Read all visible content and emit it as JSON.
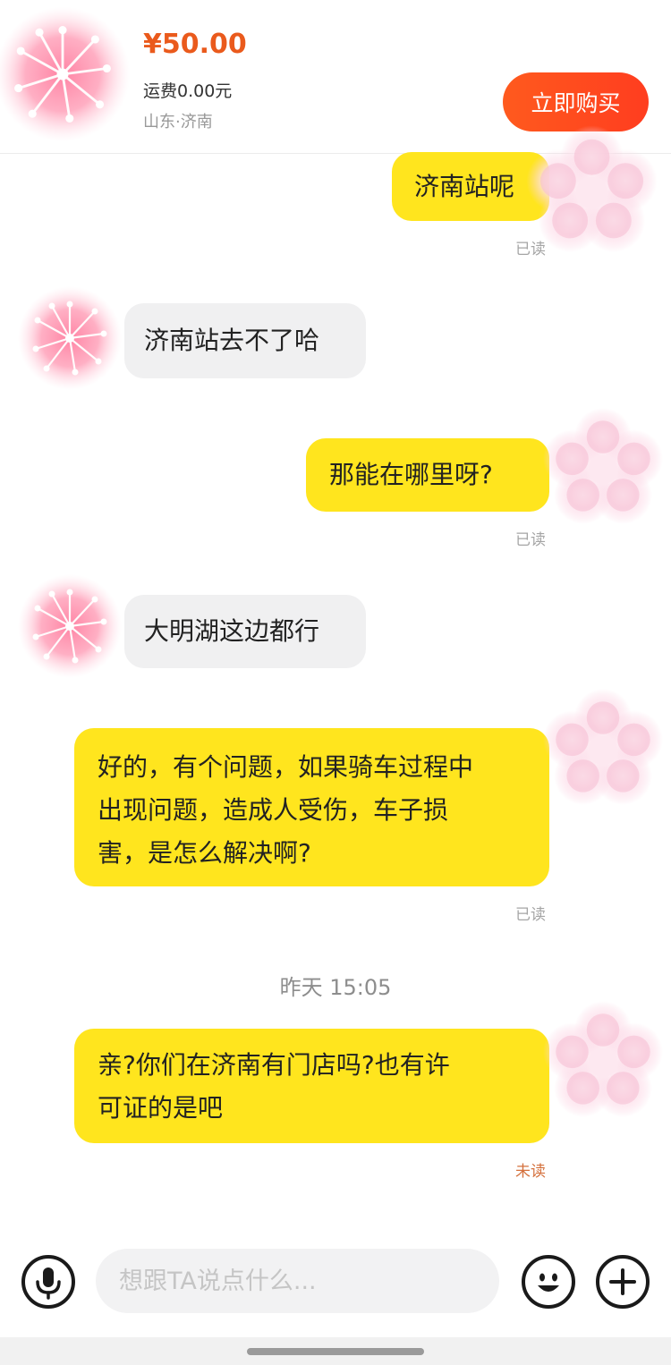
{
  "header": {
    "price": "¥50.00",
    "shipping": "运费0.00元",
    "location": "山东·济南",
    "buy_button": "立即购买"
  },
  "messages": [
    {
      "from": "me",
      "text": "济南站呢",
      "status": "已读"
    },
    {
      "from": "them",
      "text": "济南站去不了哈"
    },
    {
      "from": "me",
      "text": "那能在哪里呀?",
      "status": "已读"
    },
    {
      "from": "them",
      "text": "大明湖这边都行"
    },
    {
      "from": "me",
      "lines": [
        "好的，有个问题，如果骑车过程中",
        "出现问题，造成人受伤，车子损",
        "害，是怎么解决啊?"
      ],
      "status": "已读"
    },
    {
      "from": "me",
      "lines": [
        "亲?你们在济南有门店吗?也有许",
        "可证的是吧"
      ],
      "status": "未读"
    }
  ],
  "timestamp": "昨天 15:05",
  "input": {
    "placeholder": "想跟TA说点什么..."
  },
  "icons": {
    "voice": "microphone-icon",
    "emoji": "emoji-icon",
    "add": "plus-icon"
  },
  "colors": {
    "my_bubble": "#ffe51e",
    "their_bubble": "#f0f0f1",
    "accent": "#ff4a1e",
    "price": "#ea5a1c",
    "unread": "#d4703c"
  }
}
